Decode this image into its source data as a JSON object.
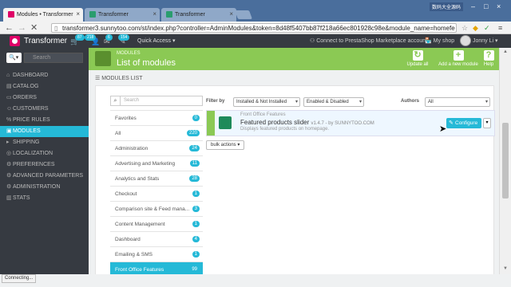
{
  "browser": {
    "tabs": [
      {
        "title": "Modules • Transformer",
        "active": true
      },
      {
        "title": "Transformer",
        "active": false
      },
      {
        "title": "Transformer",
        "active": false
      }
    ],
    "window_label": "数码大全源码",
    "url": "transformer3.sunnytoo.com/st/index.php?controller=AdminModules&token=8d48f5407bb87f218a66ec801928c98e&module_name=homefe"
  },
  "topbar": {
    "brand": "Transformer",
    "badges": [
      "87",
      "218",
      "6",
      "154"
    ],
    "quick_access": "Quick Access ▾",
    "connect": "Connect to PrestaShop Marketplace account",
    "myshop": "My shop",
    "user": "Jonny Li ▾"
  },
  "sidebar": {
    "search_placeholder": "Search",
    "items": [
      {
        "label": "DASHBOARD",
        "icon": "⌂"
      },
      {
        "label": "CATALOG",
        "icon": "▤"
      },
      {
        "label": "ORDERS",
        "icon": "▭"
      },
      {
        "label": "CUSTOMERS",
        "icon": "☺"
      },
      {
        "label": "PRICE RULES",
        "icon": "%"
      },
      {
        "label": "MODULES",
        "icon": "▣",
        "active": true
      },
      {
        "label": "SHIPPING",
        "icon": "▸"
      },
      {
        "label": "LOCALIZATION",
        "icon": "◎"
      },
      {
        "label": "PREFERENCES",
        "icon": "⚙"
      },
      {
        "label": "ADVANCED PARAMETERS",
        "icon": "⚙"
      },
      {
        "label": "ADMINISTRATION",
        "icon": "⚙"
      },
      {
        "label": "STATS",
        "icon": "▥"
      }
    ]
  },
  "header": {
    "breadcrumb": "MODULES",
    "title": "List of modules",
    "buttons": [
      {
        "label": "Update all",
        "icon": "↻"
      },
      {
        "label": "Add a new module",
        "icon": "+"
      },
      {
        "label": "Help",
        "icon": "?"
      }
    ]
  },
  "panel": {
    "title": "☰ MODULES LIST",
    "cat_search_placeholder": "Search",
    "categories": [
      {
        "label": "Favorites",
        "count": "0"
      },
      {
        "label": "All",
        "count": "220"
      },
      {
        "label": "Administration",
        "count": "24"
      },
      {
        "label": "Advertising and Marketing",
        "count": "11"
      },
      {
        "label": "Analytics and Stats",
        "count": "28"
      },
      {
        "label": "Checkout",
        "count": "1"
      },
      {
        "label": "Comparison site & Feed mana...",
        "count": "3"
      },
      {
        "label": "Content Management",
        "count": "1"
      },
      {
        "label": "Dashboard",
        "count": "4"
      },
      {
        "label": "Emailing & SMS",
        "count": "1"
      },
      {
        "label": "Front Office Features",
        "count": "99",
        "active": true
      }
    ],
    "filter_by": "Filter by",
    "filter_install": "Installed & Not Installed",
    "filter_enabled": "Enabled & Disabled",
    "authors_label": "Authors",
    "authors_value": "All",
    "module": {
      "category": "Front Office Features",
      "name": "Featured products slider",
      "version": "v1.4.7 - by SUNNYTOO.COM",
      "description": "Displays featured products on homepage.",
      "configure": "Configure",
      "dropdown": "▾"
    },
    "bulk_actions": "bulk actions ▾"
  },
  "status": "Connecting..."
}
